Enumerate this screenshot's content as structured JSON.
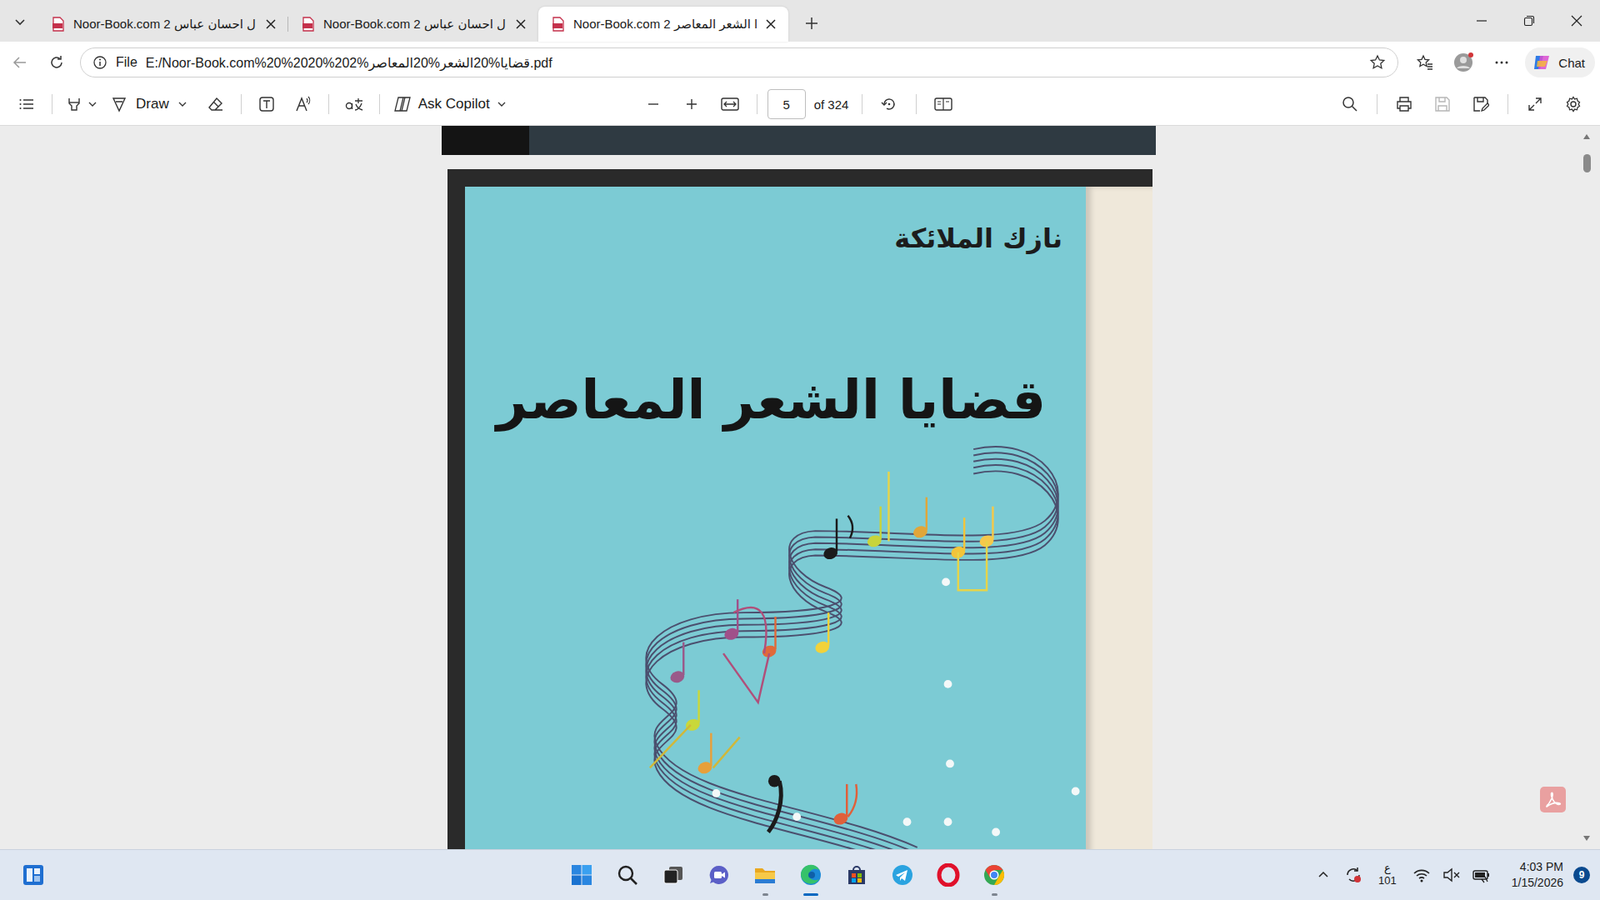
{
  "tabs": [
    {
      "label": "Noor-Book.com 2 ل احسان عباس",
      "selected": false
    },
    {
      "label": "Noor-Book.com 2 ل احسان عباس",
      "selected": false
    },
    {
      "label": "Noor-Book.com 2 ا الشعر المعاصر",
      "selected": true
    }
  ],
  "address": {
    "scheme": "File",
    "url": "E:/Noor-Book.com%20%2020%202%قضايا%20الشعر%20المعاصر.pdf"
  },
  "chat_button": "Chat",
  "pdf_toolbar": {
    "draw": "Draw",
    "copilot": "Ask Copilot",
    "page": "5",
    "page_total": "of 324",
    "save_disabled": true
  },
  "document": {
    "author": "نازك الملائكة",
    "title": "قضايا الشعر المعاصر"
  },
  "taskbar": {
    "apps": [
      {
        "kind": "start",
        "running": false,
        "active": false
      },
      {
        "kind": "search",
        "running": false,
        "active": false
      },
      {
        "kind": "taskview",
        "running": false,
        "active": false
      },
      {
        "kind": "teams",
        "running": false,
        "active": false
      },
      {
        "kind": "explorer",
        "running": true,
        "active": false
      },
      {
        "kind": "edge",
        "running": true,
        "active": true
      },
      {
        "kind": "store",
        "running": false,
        "active": false
      },
      {
        "kind": "telegram",
        "running": false,
        "active": false
      },
      {
        "kind": "opera",
        "running": false,
        "active": false
      },
      {
        "kind": "chrome",
        "running": true,
        "active": false
      }
    ]
  },
  "tray": {
    "keyboard_lang": "ع",
    "keyboard_code": "101",
    "time": "4:03 PM",
    "date": "1/15/2026",
    "notifications": "9"
  }
}
